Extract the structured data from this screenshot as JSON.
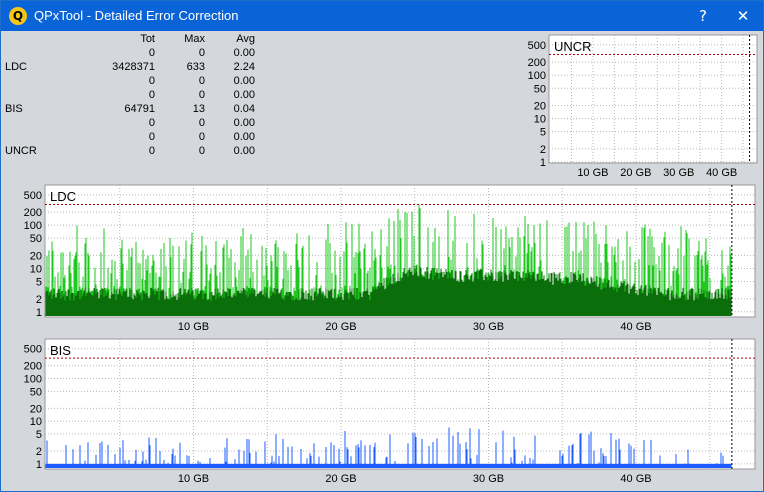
{
  "window": {
    "title": "QPxTool - Detailed Error Correction",
    "help_label": "?",
    "close_label": "✕",
    "app_icon": "Q"
  },
  "colors": {
    "titlebar": "#0a64d8",
    "panel_bg": "#d4d7db",
    "plot_bg": "#ffffff",
    "ldc_light": "#1ec81e",
    "ldc_dark": "#0a6e0a",
    "bis": "#1e5cff",
    "limit_line": "#b00000"
  },
  "stats": {
    "headers": [
      "",
      "Tot",
      "Max",
      "Avg"
    ],
    "rows": [
      [
        "",
        "0",
        "0",
        "0.00"
      ],
      [
        "LDC",
        "3428371",
        "633",
        "2.24"
      ],
      [
        "",
        "0",
        "0",
        "0.00"
      ],
      [
        "",
        "0",
        "0",
        "0.00"
      ],
      [
        "BIS",
        "64791",
        "13",
        "0.04"
      ],
      [
        "",
        "0",
        "0",
        "0.00"
      ],
      [
        "",
        "0",
        "0",
        "0.00"
      ],
      [
        "UNCR",
        "0",
        "0",
        "0.00"
      ]
    ]
  },
  "chart_data": [
    {
      "type": "bar",
      "title": "UNCR",
      "scale": "log",
      "y_ticks": [
        1,
        2,
        5,
        10,
        20,
        50,
        100,
        200,
        500
      ],
      "y_tick_labels": [
        "1",
        "2",
        "5",
        "10",
        "20",
        "50",
        "100",
        "200",
        "500"
      ],
      "x_ticks": [
        10,
        20,
        30,
        40
      ],
      "x_tick_labels": [
        "10 GB",
        "20 GB",
        "30 GB",
        "40 GB"
      ],
      "xlim": [
        0,
        48
      ],
      "ylim": [
        1,
        800
      ],
      "limit_line": 300,
      "end_marker": 46.5,
      "grid": true,
      "values": []
    },
    {
      "type": "bar",
      "title": "LDC",
      "scale": "log",
      "y_ticks": [
        1,
        2,
        5,
        10,
        20,
        50,
        100,
        200,
        500
      ],
      "y_tick_labels": [
        "1",
        "2",
        "5",
        "10",
        "20",
        "50",
        "100",
        "200",
        "500"
      ],
      "x_ticks": [
        10,
        20,
        30,
        40
      ],
      "x_tick_labels": [
        "10 GB",
        "20 GB",
        "30 GB",
        "40 GB"
      ],
      "xlim": [
        0,
        46.5
      ],
      "ylim": [
        0.8,
        800
      ],
      "limit_line": 300,
      "end_marker": 46.5,
      "grid": true,
      "series": [
        {
          "x": [
            0,
            2,
            4,
            6,
            8,
            10,
            12,
            14,
            16,
            18,
            20,
            22,
            24,
            25,
            26,
            28,
            30,
            32,
            34,
            36,
            38,
            40,
            42,
            44,
            46.5
          ],
          "max": [
            80,
            100,
            90,
            60,
            70,
            80,
            70,
            100,
            90,
            120,
            140,
            150,
            300,
            500,
            400,
            250,
            150,
            180,
            160,
            150,
            140,
            120,
            100,
            100,
            60
          ]
        },
        {
          "x": [
            0,
            2,
            4,
            6,
            8,
            10,
            12,
            14,
            16,
            18,
            20,
            22,
            24,
            25,
            26,
            28,
            30,
            32,
            34,
            36,
            38,
            40,
            42,
            44,
            46.5
          ],
          "avg": [
            3,
            3,
            3,
            3,
            3,
            3,
            3,
            3,
            3,
            3,
            3,
            3,
            8,
            10,
            9,
            8,
            8,
            8,
            7,
            7,
            5,
            4,
            3,
            3,
            3
          ]
        }
      ]
    },
    {
      "type": "bar",
      "title": "BIS",
      "scale": "log",
      "y_ticks": [
        1,
        2,
        5,
        10,
        20,
        50,
        100,
        200,
        500
      ],
      "y_tick_labels": [
        "1",
        "2",
        "5",
        "10",
        "20",
        "50",
        "100",
        "200",
        "500"
      ],
      "x_ticks": [
        10,
        20,
        30,
        40
      ],
      "x_tick_labels": [
        "10 GB",
        "20 GB",
        "30 GB",
        "40 GB"
      ],
      "xlim": [
        0,
        46.5
      ],
      "ylim": [
        0.8,
        800
      ],
      "limit_line": 300,
      "end_marker": 46.5,
      "grid": true,
      "series": [
        {
          "x": [
            0,
            2,
            4,
            6,
            8,
            10,
            12,
            14,
            16,
            18,
            20,
            22,
            24,
            25,
            26,
            28,
            30,
            32,
            34,
            36,
            38,
            40,
            42,
            44,
            46.5
          ],
          "max": [
            4,
            3,
            3,
            3,
            4,
            4,
            3,
            4,
            4,
            4,
            5,
            5,
            8,
            13,
            9,
            6,
            6,
            5,
            5,
            5,
            5,
            5,
            4,
            4,
            3
          ]
        }
      ]
    }
  ]
}
